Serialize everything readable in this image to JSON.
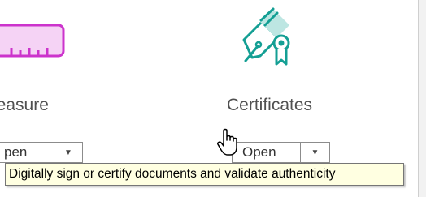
{
  "tools": [
    {
      "label": "Measure",
      "visible_label": "leasure",
      "button_label": "Open",
      "visible_button_label": "pen",
      "icon": "ruler-icon",
      "accent": "#cc33cc"
    },
    {
      "label": "Certificates",
      "button_label": "Open",
      "icon": "pen-nib-certificate-icon",
      "accent": "#149f94"
    }
  ],
  "tooltip": {
    "text": "Digitally sign or certify documents and validate authenticity"
  },
  "cursor": {
    "icon": "hand-pointer-icon"
  },
  "colors": {
    "measure_accent": "#cc33cc",
    "measure_fill": "#f5d3f5",
    "certificates_accent": "#149f94",
    "certificates_fill": "#bde6e2",
    "tooltip_bg": "#ffffe1"
  }
}
